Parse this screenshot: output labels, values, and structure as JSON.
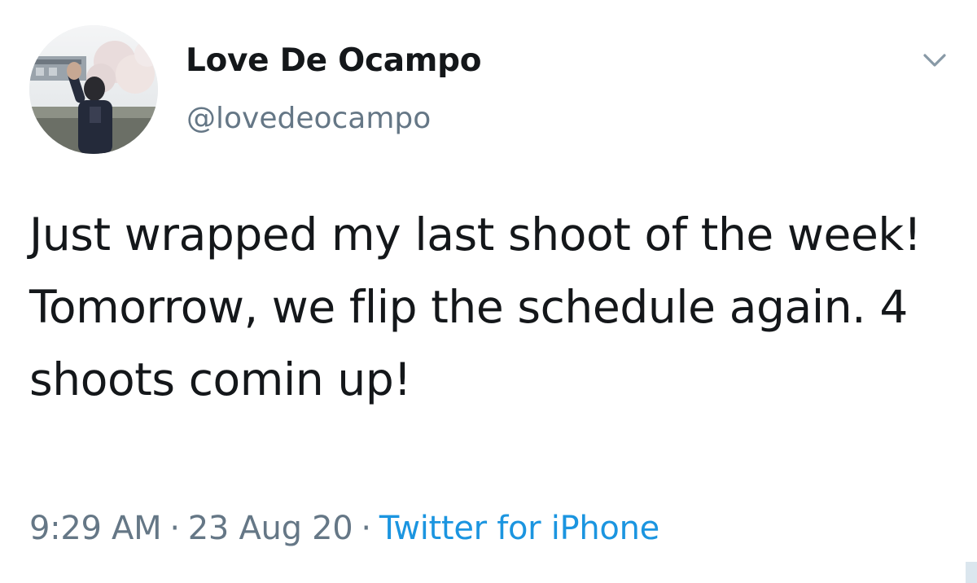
{
  "tweet": {
    "display_name": "Love De Ocampo",
    "handle": "@lovedeocampo",
    "text": "Just wrapped my last shoot of the week! Tomorrow, we flip the schedule again. 4 shoots comin up!",
    "time": "9:29 AM",
    "date": "23 Aug 20",
    "separator": "·",
    "source": "Twitter for iPhone"
  },
  "icons": {
    "menu": "chevron-down-icon",
    "avatar": "avatar"
  },
  "colors": {
    "text_primary": "#14171a",
    "text_secondary": "#657786",
    "link": "#1b95e0",
    "chevron": "#8899a6"
  }
}
